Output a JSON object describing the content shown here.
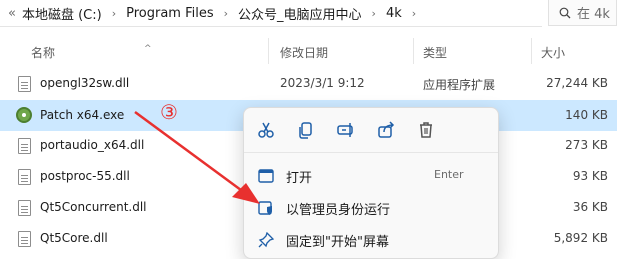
{
  "address": {
    "crumbs": [
      "本地磁盘 (C:)",
      "Program Files",
      "公众号_电脑应用中心",
      "4k"
    ],
    "overflow": "«"
  },
  "search": {
    "placeholder": "在 4k"
  },
  "columns": {
    "name": "名称",
    "date": "修改日期",
    "type": "类型",
    "size": "大小"
  },
  "files": [
    {
      "name": "opengl32sw.dll",
      "date": "2023/3/1 9:12",
      "type": "应用程序扩展",
      "size": "27,244 KB"
    },
    {
      "name": "Patch x64.exe",
      "date": "",
      "type": "",
      "size": "140 KB"
    },
    {
      "name": "portaudio_x64.dll",
      "date": "",
      "type": "",
      "size": "273 KB"
    },
    {
      "name": "postproc-55.dll",
      "date": "",
      "type": "",
      "size": "93 KB"
    },
    {
      "name": "Qt5Concurrent.dll",
      "date": "",
      "type": "",
      "size": "36 KB"
    },
    {
      "name": "Qt5Core.dll",
      "date": "",
      "type": "",
      "size": "5,892 KB"
    }
  ],
  "context_menu": {
    "items": [
      {
        "label": "打开",
        "shortcut": "Enter"
      },
      {
        "label": "以管理员身份运行",
        "shortcut": ""
      },
      {
        "label": "固定到\"开始\"屏幕",
        "shortcut": ""
      }
    ]
  },
  "annotation": {
    "step": "③",
    "color": "#e8302f"
  },
  "colors": {
    "selection": "#cce8ff",
    "accent": "#0067c0"
  }
}
